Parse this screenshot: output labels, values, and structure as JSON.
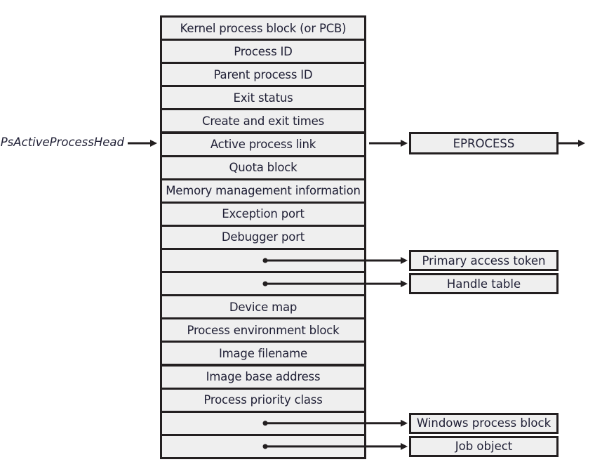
{
  "head_label": "PsActiveProcessHead",
  "rows": [
    "Kernel process block (or PCB)",
    "Process ID",
    "Parent process ID",
    "Exit status",
    "Create and exit times",
    "Active process link",
    "Quota block",
    "Memory management information",
    "Exception port",
    "Debugger port",
    "",
    "",
    "Device map",
    "Process environment block",
    "Image filename",
    "Image base address",
    "Process priority class",
    "",
    ""
  ],
  "eprocess_label": "EPROCESS",
  "pointers": [
    {
      "row": 10,
      "label": "Primary access token"
    },
    {
      "row": 11,
      "label": "Handle table"
    },
    {
      "row": 17,
      "label": "Windows process block"
    },
    {
      "row": 18,
      "label": "Job object"
    }
  ]
}
